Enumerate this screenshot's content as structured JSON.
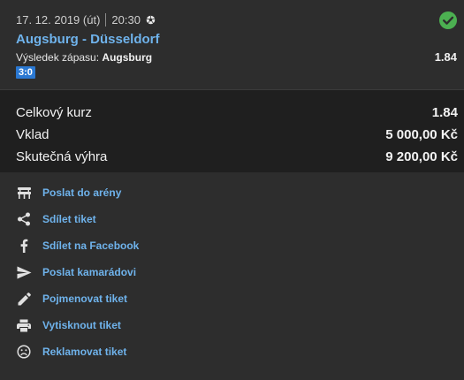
{
  "bet": {
    "date": "17. 12. 2019 (út)",
    "time": "20:30",
    "sport_icon": "soccer-ball-icon",
    "status_icon": "check-circle-icon",
    "status_color": "#4cb051",
    "match": "Augsburg - Düsseldorf",
    "market_label": "Výsledek zápasu:",
    "selection": "Augsburg",
    "odd": "1.84",
    "score": "3:0"
  },
  "summary": {
    "total_odds_label": "Celkový kurz",
    "total_odds_value": "1.84",
    "stake_label": "Vklad",
    "stake_value": "5 000,00 Kč",
    "win_label": "Skutečná výhra",
    "win_value": "9 200,00 Kč"
  },
  "actions": [
    {
      "label": "Poslat do arény",
      "icon": "arena-icon"
    },
    {
      "label": "Sdílet tiket",
      "icon": "share-icon"
    },
    {
      "label": "Sdílet na Facebook",
      "icon": "facebook-icon"
    },
    {
      "label": "Poslat kamarádovi",
      "icon": "send-icon"
    },
    {
      "label": "Pojmenovat tiket",
      "icon": "pencil-icon"
    },
    {
      "label": "Vytisknout tiket",
      "icon": "printer-icon"
    },
    {
      "label": "Reklamovat tiket",
      "icon": "sad-face-icon"
    }
  ],
  "colors": {
    "link": "#6fb3ec",
    "score_badge": "#2a78d2",
    "background": "#2d2d2d",
    "summary_background": "#1f1f1f"
  }
}
